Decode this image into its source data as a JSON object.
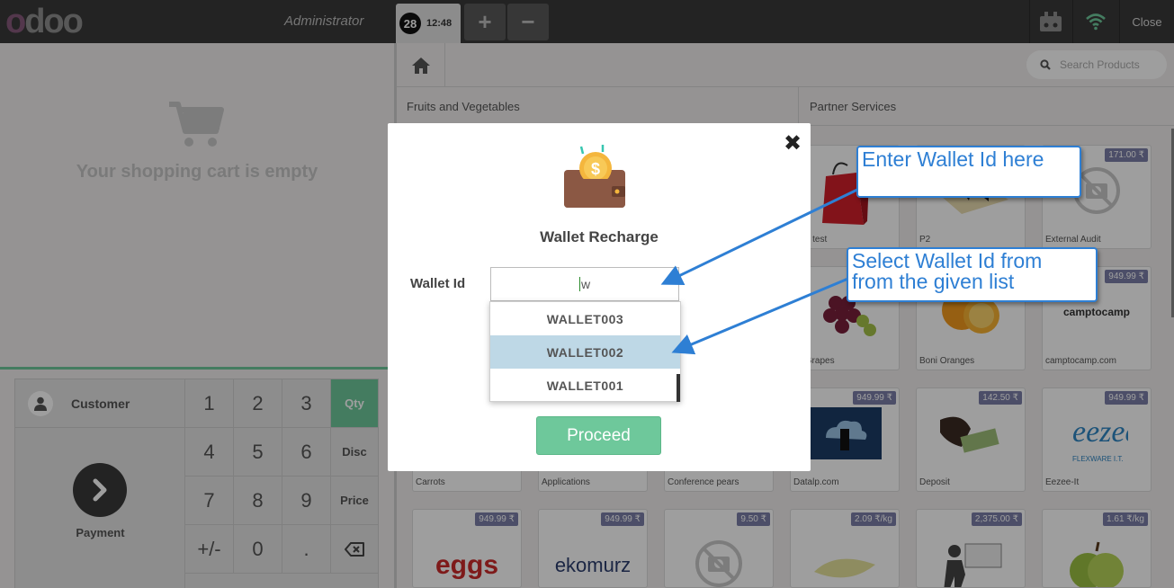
{
  "header": {
    "logo_o": "o",
    "logo_rest": "doo",
    "user": "Administrator",
    "order_number": "28",
    "order_time": "12:48",
    "add_label": "+",
    "remove_label": "−",
    "close_label": "Close",
    "icons": [
      "barcode-scanner-icon",
      "wifi-icon"
    ]
  },
  "cart": {
    "empty_message": "Your shopping cart is empty"
  },
  "numpad": {
    "customer_label": "Customer",
    "payment_label": "Payment",
    "keys": [
      "1",
      "2",
      "3",
      "Qty",
      "4",
      "5",
      "6",
      "Disc",
      "7",
      "8",
      "9",
      "Price",
      "+/-",
      "0",
      ".",
      "⌫"
    ],
    "active_mode": "Qty"
  },
  "products_header": {
    "search_placeholder": "Search Products",
    "categories": [
      "Fruits and Vegetables",
      "Partner Services"
    ]
  },
  "products": [
    {
      "name": "final test",
      "price": ""
    },
    {
      "name": "P2",
      "price": ""
    },
    {
      "name": "External Audit",
      "price": "171.00 ₹"
    },
    {
      "name": "ck Grapes",
      "price": ""
    },
    {
      "name": "Boni Oranges",
      "price": ""
    },
    {
      "name": "camptocamp.com",
      "price": "949.99 ₹"
    },
    {
      "name": "Carrots",
      "price": ""
    },
    {
      "name": "Applications",
      "price": ""
    },
    {
      "name": "Conference pears",
      "price": ""
    },
    {
      "name": "Datalp.com",
      "price": "949.99 ₹"
    },
    {
      "name": "Deposit",
      "price": "142.50 ₹"
    },
    {
      "name": "Eezee-It",
      "price": "949.99 ₹"
    },
    {
      "name": "",
      "price": "949.99 ₹"
    },
    {
      "name": "",
      "price": "949.99 ₹"
    },
    {
      "name": "",
      "price": "9.50 ₹"
    },
    {
      "name": "",
      "price": "2.09 ₹/kg"
    },
    {
      "name": "",
      "price": "2,375.00 ₹"
    },
    {
      "name": "",
      "price": "1.61 ₹/kg"
    }
  ],
  "logo_texts": {
    "camptocamp": "camptocamp",
    "eggs": "eggs",
    "ekomurz": "ekomurz",
    "eezee_sub": "FLEXWARE I.T."
  },
  "modal": {
    "title": "Wallet Recharge",
    "field_label": "Wallet Id",
    "field_value": "w",
    "options": [
      "WALLET003",
      "WALLET002",
      "WALLET001"
    ],
    "selected_option": "WALLET002",
    "proceed_label": "Proceed"
  },
  "annotations": {
    "callout1": "Enter Wallet Id here",
    "callout2_line1": "Select Wallet Id from",
    "callout2_line2": "from the given list",
    "color": "#2e7fd4"
  },
  "colors": {
    "accent": "#6ec89b",
    "topbar": "#393939",
    "price_badge": "#7b7fa8",
    "dropdown_selected": "#bed8e6"
  }
}
